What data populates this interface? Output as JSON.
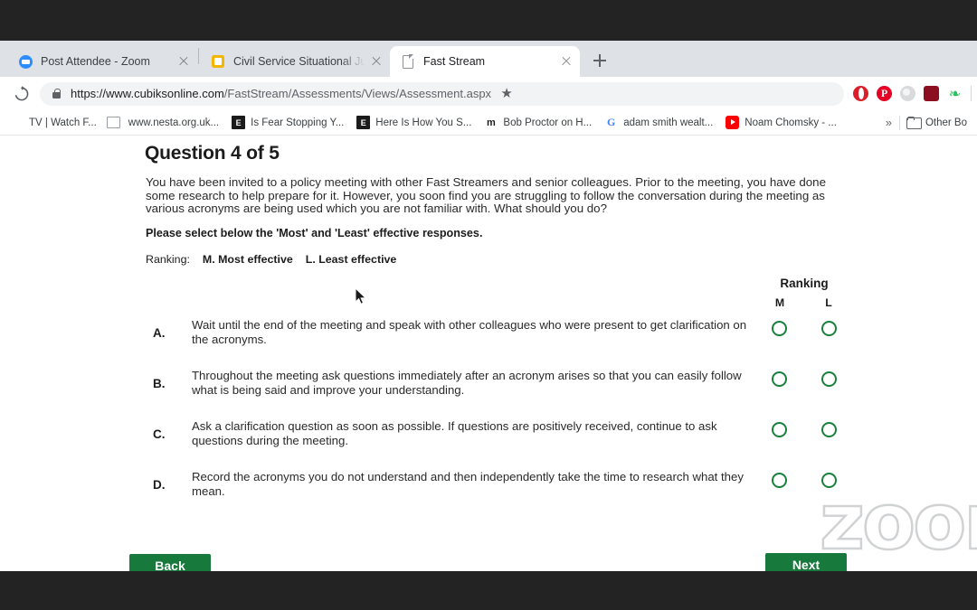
{
  "browser": {
    "tabs": [
      {
        "title": "Post Attendee - Zoom",
        "icon": "zoom-icon",
        "active": false
      },
      {
        "title": "Civil Service Situational Judge",
        "icon": "square-yellow-icon",
        "active": false
      },
      {
        "title": "Fast Stream",
        "icon": "document-icon",
        "active": true
      }
    ],
    "new_tab_label": "+",
    "reload_icon": "reload-icon",
    "address": {
      "lock_icon": "lock-icon",
      "scheme_host": "https://www.cubiksonline.com",
      "path": "/FastStream/Assessments/Views/Assessment.aspx",
      "full_url": "https://www.cubiksonline.com/FastStream/Assessments/Views/Assessment.aspx"
    },
    "star_icon": "★",
    "extensions": [
      {
        "name": "opera-extension-icon",
        "glyph": ""
      },
      {
        "name": "pinterest-extension-icon",
        "glyph": "P"
      },
      {
        "name": "grey-circle-extension-icon",
        "glyph": ""
      },
      {
        "name": "red-square-extension-icon",
        "glyph": ""
      },
      {
        "name": "evernote-extension-icon",
        "glyph": "❧"
      }
    ],
    "bookmarks": [
      {
        "label": "TV | Watch F...",
        "icon": "page-icon"
      },
      {
        "label": "www.nesta.org.uk...",
        "icon": "page-icon"
      },
      {
        "label": "Is Fear Stopping Y...",
        "icon": "black-square-icon"
      },
      {
        "label": "Here Is How You S...",
        "icon": "black-square-icon"
      },
      {
        "label": "Bob Proctor on H...",
        "icon": "medium-icon"
      },
      {
        "label": "adam smith wealt...",
        "icon": "google-icon"
      },
      {
        "label": "Noam Chomsky - ...",
        "icon": "youtube-icon"
      }
    ],
    "bookmark_overflow": "»",
    "other_bookmarks_label": "Other Bo"
  },
  "assessment": {
    "title": "Question 4 of 5",
    "stem": "You have been invited to a policy meeting with other Fast Streamers and senior colleagues. Prior to the meeting, you have done some research to help prepare for it. However, you soon find you are struggling to follow the conversation during the meeting as various acronyms are being used which you are not familiar with. What should you do?",
    "instruction": "Please select below the 'Most' and 'Least' effective responses.",
    "ranking_prefix": "Ranking:",
    "ranking_most": "M. Most effective",
    "ranking_least": "L. Least effective",
    "ranking_header": "Ranking",
    "col_m": "M",
    "col_l": "L",
    "options": [
      {
        "letter": "A.",
        "text": "Wait until the end of the meeting and speak with other colleagues who were present to get clarification on the acronyms.",
        "m_selected": false,
        "l_selected": false
      },
      {
        "letter": "B.",
        "text": "Throughout the meeting ask questions immediately after an acronym arises so that you can easily follow what is being said and improve your understanding.",
        "m_selected": false,
        "l_selected": false
      },
      {
        "letter": "C.",
        "text": "Ask a clarification question as soon as possible. If questions are positively received, continue to ask questions during the meeting.",
        "m_selected": false,
        "l_selected": false
      },
      {
        "letter": "D.",
        "text": "Record the acronyms you do not understand and then independently take the time to research what they mean.",
        "m_selected": false,
        "l_selected": false
      }
    ],
    "back_button": "Back",
    "next_button": "Next",
    "accent_green": "#17793c"
  },
  "overlay": {
    "watermark": "zoom",
    "cursor_icon": "mouse-pointer"
  }
}
